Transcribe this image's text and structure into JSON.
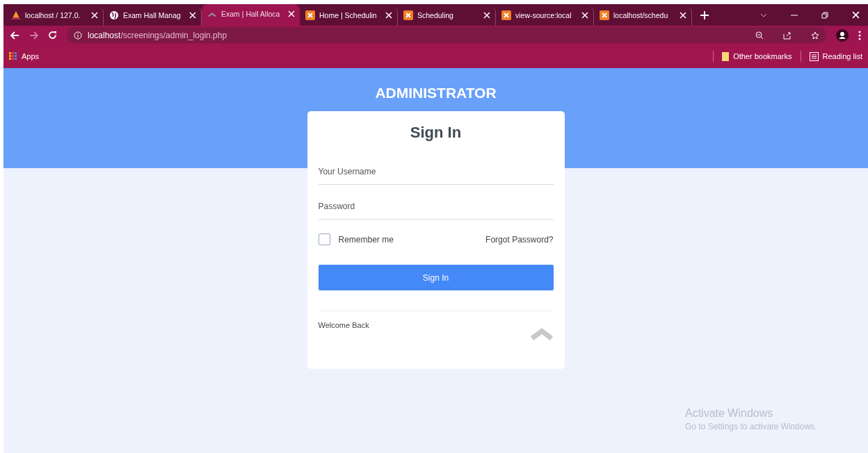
{
  "browser": {
    "tabs": [
      {
        "title": "localhost / 127.0.",
        "selected": false
      },
      {
        "title": "Exam Hall Manag",
        "selected": false
      },
      {
        "title": "Exam | Hall Alloca",
        "selected": true
      },
      {
        "title": "Home | Schedulin",
        "selected": false
      },
      {
        "title": "Scheduling",
        "selected": false
      },
      {
        "title": "view-source:local",
        "selected": false
      },
      {
        "title": "localhost/schedu",
        "selected": false
      }
    ],
    "url": "**localhost**/screenings/admin_login.php",
    "bookmarks": {
      "apps": "Apps",
      "other": "Other bookmarks",
      "reading": "Reading list"
    }
  },
  "page": {
    "header": "ADMINISTRATOR",
    "card": {
      "title": "Sign In",
      "username": {
        "placeholder": "Your Username"
      },
      "password": {
        "placeholder": "Password"
      },
      "remember": {
        "label": "Remember me",
        "checked": false
      },
      "forgot": "Forgot Password?",
      "submit": "Sign In",
      "footer": "Welcome Back"
    }
  },
  "os_notice": {
    "title": "Activate Windows",
    "text": "Go to Settings to activate Windows."
  }
}
